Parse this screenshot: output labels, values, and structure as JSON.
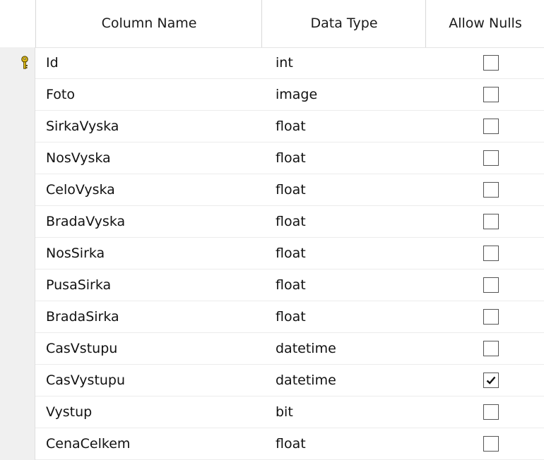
{
  "columns": {
    "name": "Column Name",
    "type": "Data Type",
    "nulls": "Allow Nulls"
  },
  "rows": [
    {
      "name": "Id",
      "type": "int",
      "allow_nulls": false,
      "primary_key": true
    },
    {
      "name": "Foto",
      "type": "image",
      "allow_nulls": false,
      "primary_key": false
    },
    {
      "name": "SirkaVyska",
      "type": "float",
      "allow_nulls": false,
      "primary_key": false
    },
    {
      "name": "NosVyska",
      "type": "float",
      "allow_nulls": false,
      "primary_key": false
    },
    {
      "name": "CeloVyska",
      "type": "float",
      "allow_nulls": false,
      "primary_key": false
    },
    {
      "name": "BradaVyska",
      "type": "float",
      "allow_nulls": false,
      "primary_key": false
    },
    {
      "name": "NosSirka",
      "type": "float",
      "allow_nulls": false,
      "primary_key": false
    },
    {
      "name": "PusaSirka",
      "type": "float",
      "allow_nulls": false,
      "primary_key": false
    },
    {
      "name": "BradaSirka",
      "type": "float",
      "allow_nulls": false,
      "primary_key": false
    },
    {
      "name": "CasVstupu",
      "type": "datetime",
      "allow_nulls": false,
      "primary_key": false
    },
    {
      "name": "CasVystupu",
      "type": "datetime",
      "allow_nulls": true,
      "primary_key": false
    },
    {
      "name": "Vystup",
      "type": "bit",
      "allow_nulls": false,
      "primary_key": false
    },
    {
      "name": "CenaCelkem",
      "type": "float",
      "allow_nulls": false,
      "primary_key": false
    }
  ],
  "icons": {
    "primary_key": "key-icon",
    "checked": "checkmark-icon"
  },
  "colors": {
    "selector_bg": "#f0f0f0",
    "key_gold": "#e8c21a"
  }
}
